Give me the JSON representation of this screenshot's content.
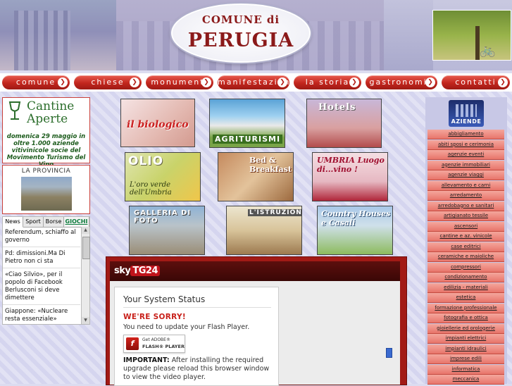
{
  "header": {
    "logo_top": "COMUNE di",
    "logo_main": "PERUGIA"
  },
  "nav": [
    {
      "label": "comune"
    },
    {
      "label": "chiese"
    },
    {
      "label": "monumenti"
    },
    {
      "label": "manifestazioni"
    },
    {
      "label": "la storia"
    },
    {
      "label": "gastronomia"
    },
    {
      "label": "contatti"
    }
  ],
  "nav_arrow": "❯",
  "cantine": {
    "title1": "Cantine",
    "title2": "Aperte",
    "text": "domenica 29 maggio in oltre 1.000 aziende vitivinicole socie del Movimento Turismo del Vino"
  },
  "provincia": {
    "title": "LA PROVINCIA"
  },
  "news": {
    "tabs": [
      "News",
      "Sport",
      "Borse",
      "GIOCHI"
    ],
    "items": [
      "Referendum, schiaffo al governo",
      "Pd: dimissioni.Ma Di Pietro non ci sta",
      "«Ciao Silvio», per il popolo di Facebook Berlusconi si deve dimettere",
      "Giappone: «Nucleare resta essenziale»"
    ]
  },
  "tiles": {
    "bio": "il biologico",
    "agri": "AGRITURISMI",
    "hotels": "Hotels",
    "olio": "OLIO",
    "olio_sub": "L'oro verde dell'Umbria",
    "bnb": "Bed & Breakfast",
    "umbria": "UMBRIA Luogo di...vino !",
    "gall": "GALLERIA DI FOTO",
    "istr": "L'ISTRUZIONE",
    "country": "Country Houses e Casali"
  },
  "player": {
    "brand_sky": "sky",
    "brand_tg": "TG24",
    "status_title": "Your System Status",
    "sorry": "WE'RE SORRY!",
    "need": "You need to update your Flash Player.",
    "flash_get": "Get ADOBE®",
    "flash_name": "FLASH® PLAYER",
    "important_label": "IMPORTANT:",
    "important_text": "After installing the required upgrade please reload this browser window to view the video player."
  },
  "aziende": {
    "title": "AZIENDE",
    "items": [
      "abbigliamento",
      "abiti sposi e cerimonia",
      "agenzie eventi",
      "agenzie immobiliari",
      "agenzie viaggi",
      "allevamento e carni",
      "arredamento",
      "arredobagno e sanitari",
      "artigianato tessile",
      "ascensori",
      "cantine e az. vinicole",
      "case editrici",
      "ceramiche e maioliche",
      "compressori",
      "condizionamento",
      "edilizia - materiali",
      "estetica",
      "formazione professionale",
      "fotografia e ottica",
      "gioiellerie ed orologerie",
      "impianti elettrici",
      "impianti idraulici",
      "imprese edili",
      "informatica",
      "meccanica"
    ]
  }
}
